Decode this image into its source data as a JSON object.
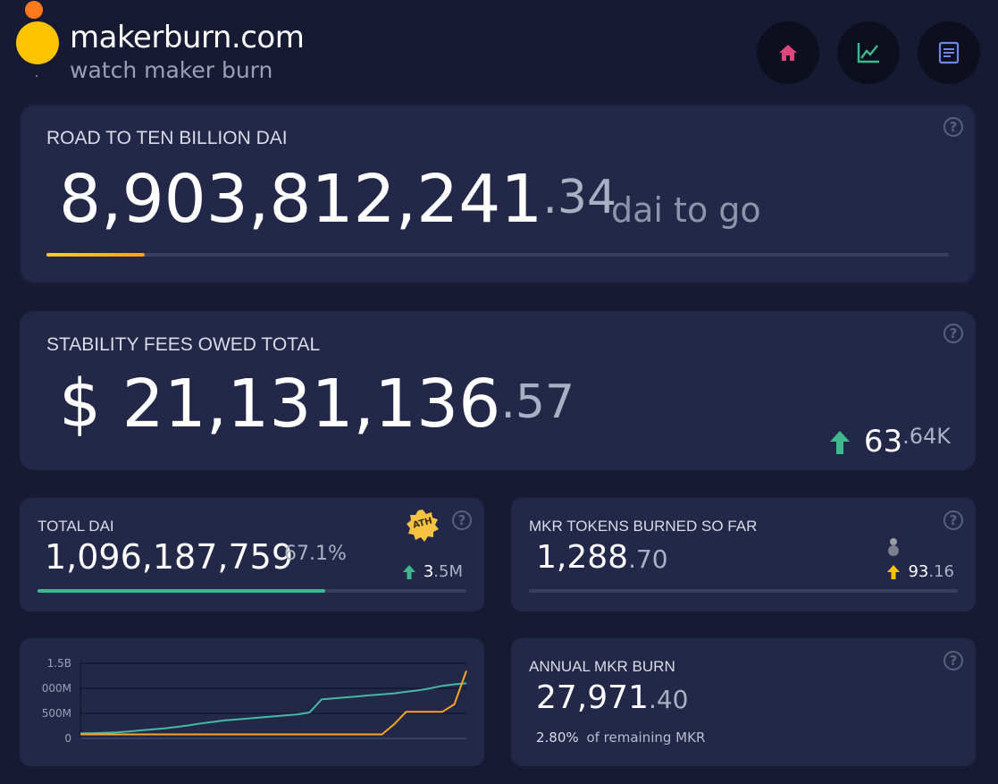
{
  "header": {
    "brand": "makerburn.com",
    "tagline": "watch maker burn",
    "nav": [
      "home-icon",
      "chart-line-icon",
      "document-icon"
    ]
  },
  "road": {
    "title": "ROAD TO TEN BILLION DAI",
    "value_int": "8,903,812,241",
    "value_dec": ".34",
    "suffix": "dai to go",
    "progress": 0.109
  },
  "fees": {
    "title": "STABILITY FEES OWED TOTAL",
    "currency": "$",
    "value_int": "21,131,136",
    "value_dec": ".57",
    "change_int": "63",
    "change_dec": ".64K"
  },
  "total_dai": {
    "title": "TOTAL DAI",
    "value": "1,096,187,759",
    "percent": "67.1%",
    "badge": "ATH",
    "change_int": "3",
    "change_dec": ".5M",
    "progress": 0.671
  },
  "mkr_burned": {
    "title": "MKR TOKENS BURNED SO FAR",
    "value_int": "1,288",
    "value_dec": ".70",
    "change_int": "93",
    "change_dec": ".16"
  },
  "annual": {
    "title": "ANNUAL MKR BURN",
    "value_int": "27,971",
    "value_dec": ".40",
    "percent": "2.80%",
    "sub": "of remaining MKR"
  },
  "chart_data": {
    "type": "line",
    "ytick_labels": [
      "1.5B",
      "000M",
      "500M",
      "0"
    ],
    "ylim": [
      0,
      1500000000
    ],
    "grid": true,
    "series": [
      {
        "color": "#45b8a6",
        "values": [
          100000000,
          105000000,
          110000000,
          120000000,
          140000000,
          160000000,
          180000000,
          200000000,
          230000000,
          260000000,
          300000000,
          330000000,
          360000000,
          380000000,
          400000000,
          420000000,
          440000000,
          460000000,
          480000000,
          520000000,
          780000000,
          800000000,
          820000000,
          840000000,
          860000000,
          880000000,
          900000000,
          930000000,
          960000000,
          1000000000,
          1050000000,
          1080000000,
          1100000000
        ]
      },
      {
        "color": "#f5a623",
        "values": [
          80000000,
          80000000,
          80000000,
          80000000,
          80000000,
          80000000,
          80000000,
          80000000,
          80000000,
          80000000,
          80000000,
          80000000,
          80000000,
          80000000,
          80000000,
          80000000,
          80000000,
          80000000,
          80000000,
          80000000,
          80000000,
          80000000,
          80000000,
          80000000,
          80000000,
          80000000,
          280000000,
          530000000,
          530000000,
          530000000,
          530000000,
          680000000,
          1350000000
        ]
      }
    ]
  },
  "colors": {
    "accent_green": "#3fb88e",
    "accent_orange": "#ffaa1c",
    "home_pink": "#e0457b"
  }
}
